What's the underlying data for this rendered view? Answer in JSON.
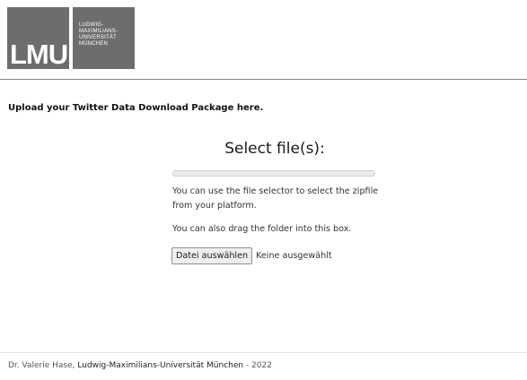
{
  "logo": {
    "abbr": "LMU",
    "lines": [
      "LUDWIG-",
      "MAXIMILIANS-",
      "UNIVERSITÄT",
      "MÜNCHEN"
    ]
  },
  "intro": "Upload your Twitter Data Download Package here.",
  "upload": {
    "title": "Select file(s):",
    "progress": 0,
    "hint_1": "You can use the file selector to select the zipfile from your platform.",
    "hint_2": "You can also drag the folder into this box.",
    "file_button": "Datei auswählen",
    "file_status": "Keine ausgewählt"
  },
  "footer": {
    "author": "Dr. Valerie Hase,",
    "institution": "Ludwig-Maximilians-Universität München",
    "year": "- 2022"
  },
  "colors": {
    "logo_gray": "#6d6d6d",
    "progress_accent": "#3a7bd5"
  }
}
